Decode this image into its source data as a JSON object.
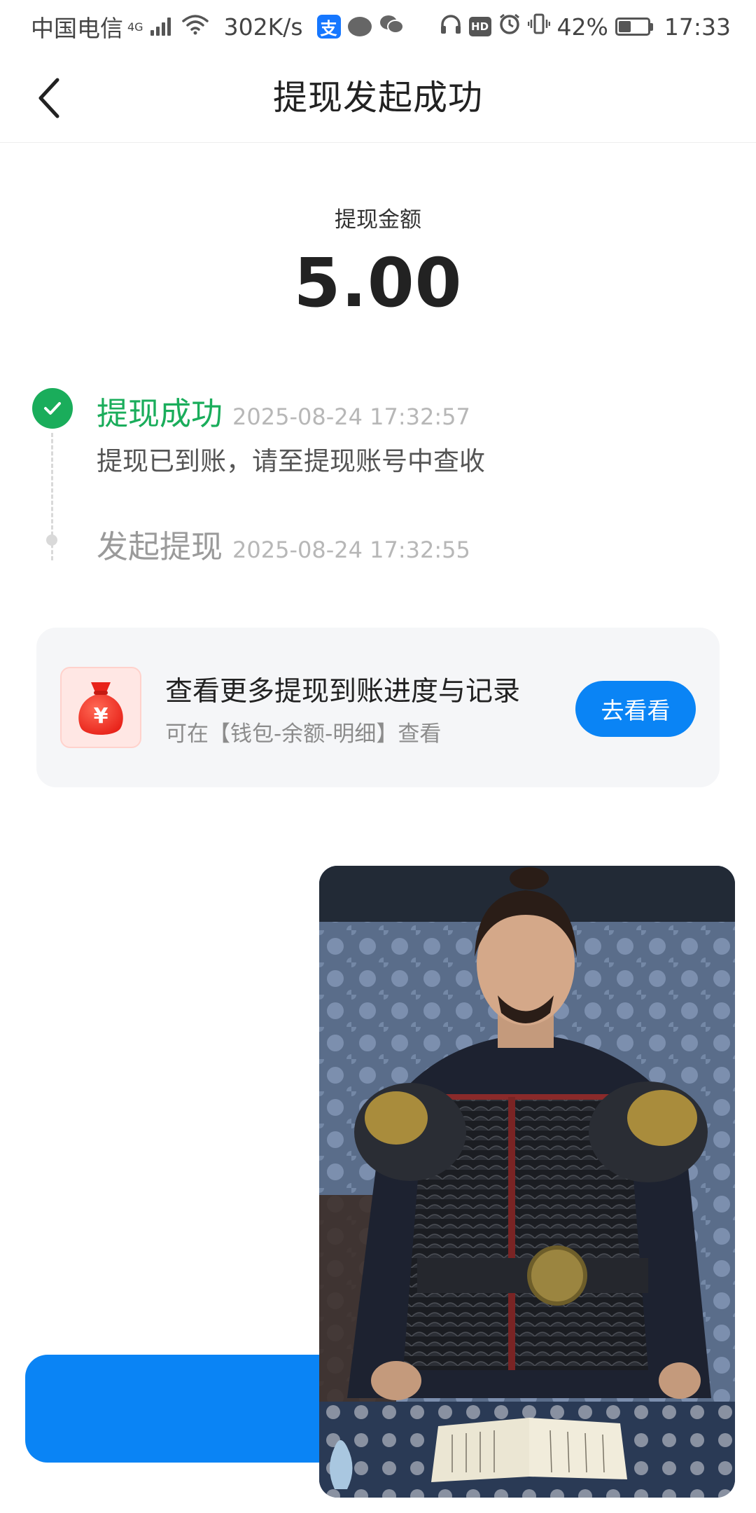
{
  "status_bar": {
    "carrier": "中国电信",
    "network_type": "4G",
    "speed": "302K/s",
    "battery_percent": "42%",
    "time": "17:33",
    "app_badge_text": "支",
    "hd_text": "HD"
  },
  "nav": {
    "title": "提现发起成功"
  },
  "amount": {
    "label": "提现金额",
    "value": "5.00"
  },
  "timeline": {
    "steps": [
      {
        "title": "提现成功",
        "time": "2025-08-24 17:32:57",
        "desc": "提现已到账，请至提现账号中查收"
      },
      {
        "title": "发起提现",
        "time": "2025-08-24 17:32:55"
      }
    ]
  },
  "promo": {
    "title": "查看更多提现到账进度与记录",
    "subtitle": "可在【钱包-余额-明细】查看",
    "button_label": "去看看",
    "icon_symbol": "¥"
  },
  "colors": {
    "accent_blue": "#0a84f5",
    "success_green": "#1aad5b",
    "muted_gray": "#b7b7b7",
    "card_bg": "#f5f6f8"
  },
  "icons": {
    "back": "chevron-left-icon",
    "check": "check-circle-icon",
    "money_bag": "money-bag-icon",
    "wifi": "wifi-icon",
    "signal": "signal-icon",
    "battery": "battery-icon",
    "alarm": "alarm-icon",
    "vibrate": "vibrate-icon",
    "headphones": "headphones-icon"
  }
}
